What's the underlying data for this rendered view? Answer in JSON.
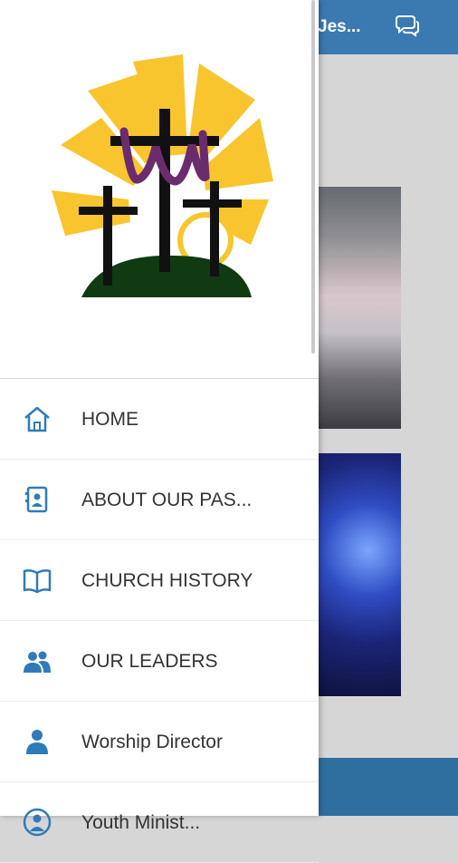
{
  "app": {
    "header_title": "Jes...",
    "chat_icon": "chat-bubbles-icon"
  },
  "drawer": {
    "logo_icon": "three-crosses-sunrise-logo",
    "items": [
      {
        "label": "HOME",
        "icon": "home-icon"
      },
      {
        "label": "ABOUT OUR PAS...",
        "icon": "contact-card-icon"
      },
      {
        "label": "CHURCH HISTORY",
        "icon": "open-book-icon"
      },
      {
        "label": "OUR LEADERS",
        "icon": "people-icon"
      },
      {
        "label": "Worship Director",
        "icon": "person-icon"
      },
      {
        "label": "Youth Minist...",
        "icon": "circle-user-icon"
      }
    ]
  },
  "colors": {
    "header_blue": "#3a7ab0",
    "icon_blue": "#2f7bb8",
    "menu_text": "#333333"
  }
}
